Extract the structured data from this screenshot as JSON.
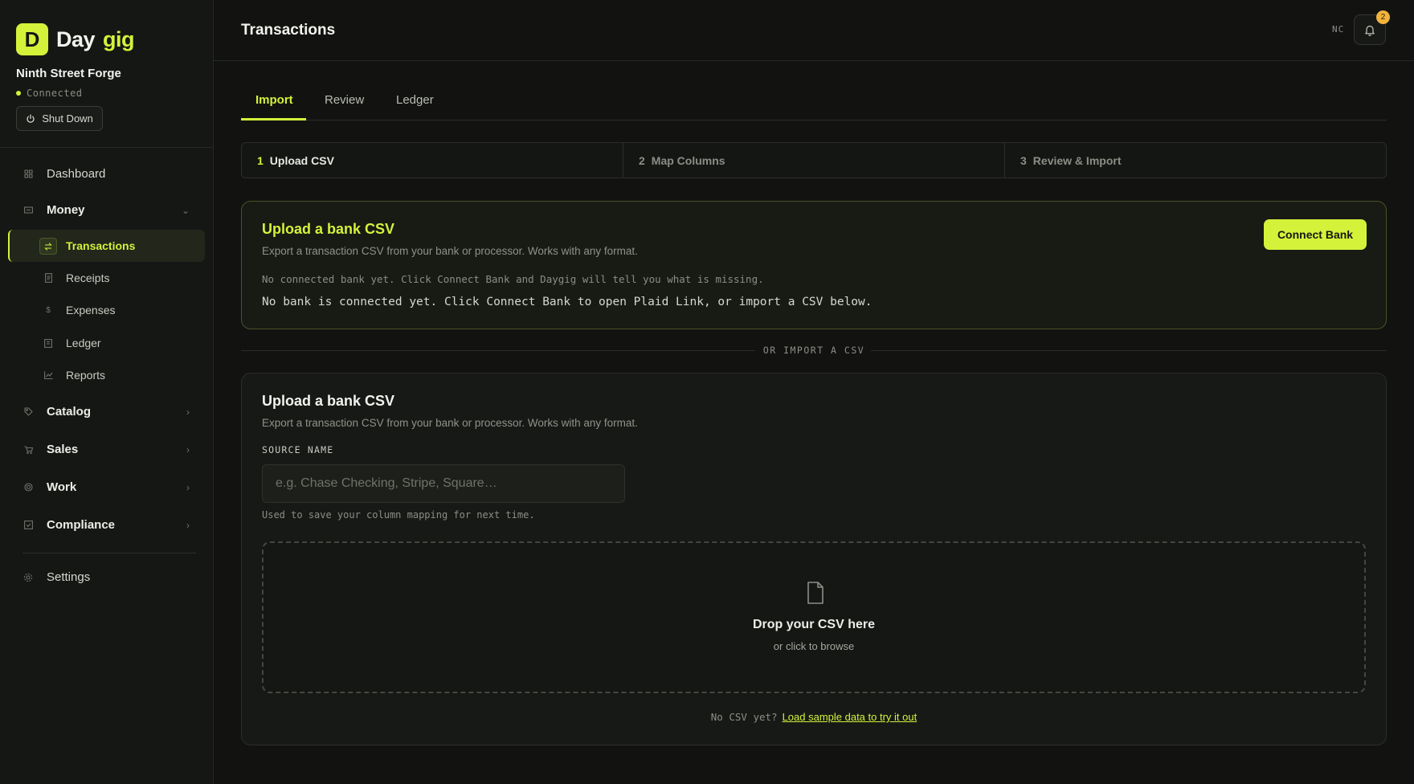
{
  "brand": {
    "badge": "D",
    "word1": "Day",
    "word2": "gig"
  },
  "org": {
    "name": "Ninth Street Forge",
    "status": "Connected",
    "shutdown_label": "Shut Down"
  },
  "nav": {
    "dashboard": "Dashboard",
    "money": "Money",
    "money_items": {
      "transactions": "Transactions",
      "receipts": "Receipts",
      "expenses": "Expenses",
      "ledger": "Ledger",
      "reports": "Reports"
    },
    "catalog": "Catalog",
    "sales": "Sales",
    "work": "Work",
    "compliance": "Compliance",
    "settings": "Settings"
  },
  "header": {
    "title": "Transactions",
    "user_initials": "NC",
    "notification_count": "2"
  },
  "tabs": [
    "Import",
    "Review",
    "Ledger"
  ],
  "steps": [
    {
      "num": "1",
      "label": "Upload CSV"
    },
    {
      "num": "2",
      "label": "Map Columns"
    },
    {
      "num": "3",
      "label": "Review & Import"
    }
  ],
  "connect_card": {
    "title": "Upload a bank CSV",
    "description": "Export a transaction CSV from your bank or processor. Works with any format.",
    "note": "No connected bank yet. Click Connect Bank and Daygig will tell you what is missing.",
    "message": "No bank is connected yet. Click Connect Bank to open Plaid Link, or import a CSV below.",
    "button": "Connect Bank"
  },
  "divider_text": "OR IMPORT A CSV",
  "upload_card": {
    "title": "Upload a bank CSV",
    "description": "Export a transaction CSV from your bank or processor. Works with any format.",
    "source_label": "SOURCE NAME",
    "source_placeholder": "e.g. Chase Checking, Stripe, Square…",
    "source_value": "",
    "help": "Used to save your column mapping for next time.",
    "dropzone_title": "Drop your CSV here",
    "dropzone_sub": "or click to browse",
    "sample_prefix": "No CSV yet?",
    "sample_link": "Load sample data to try it out"
  },
  "colors": {
    "accent": "#d4f23a",
    "background": "#121311",
    "badge": "#f2b33d"
  }
}
